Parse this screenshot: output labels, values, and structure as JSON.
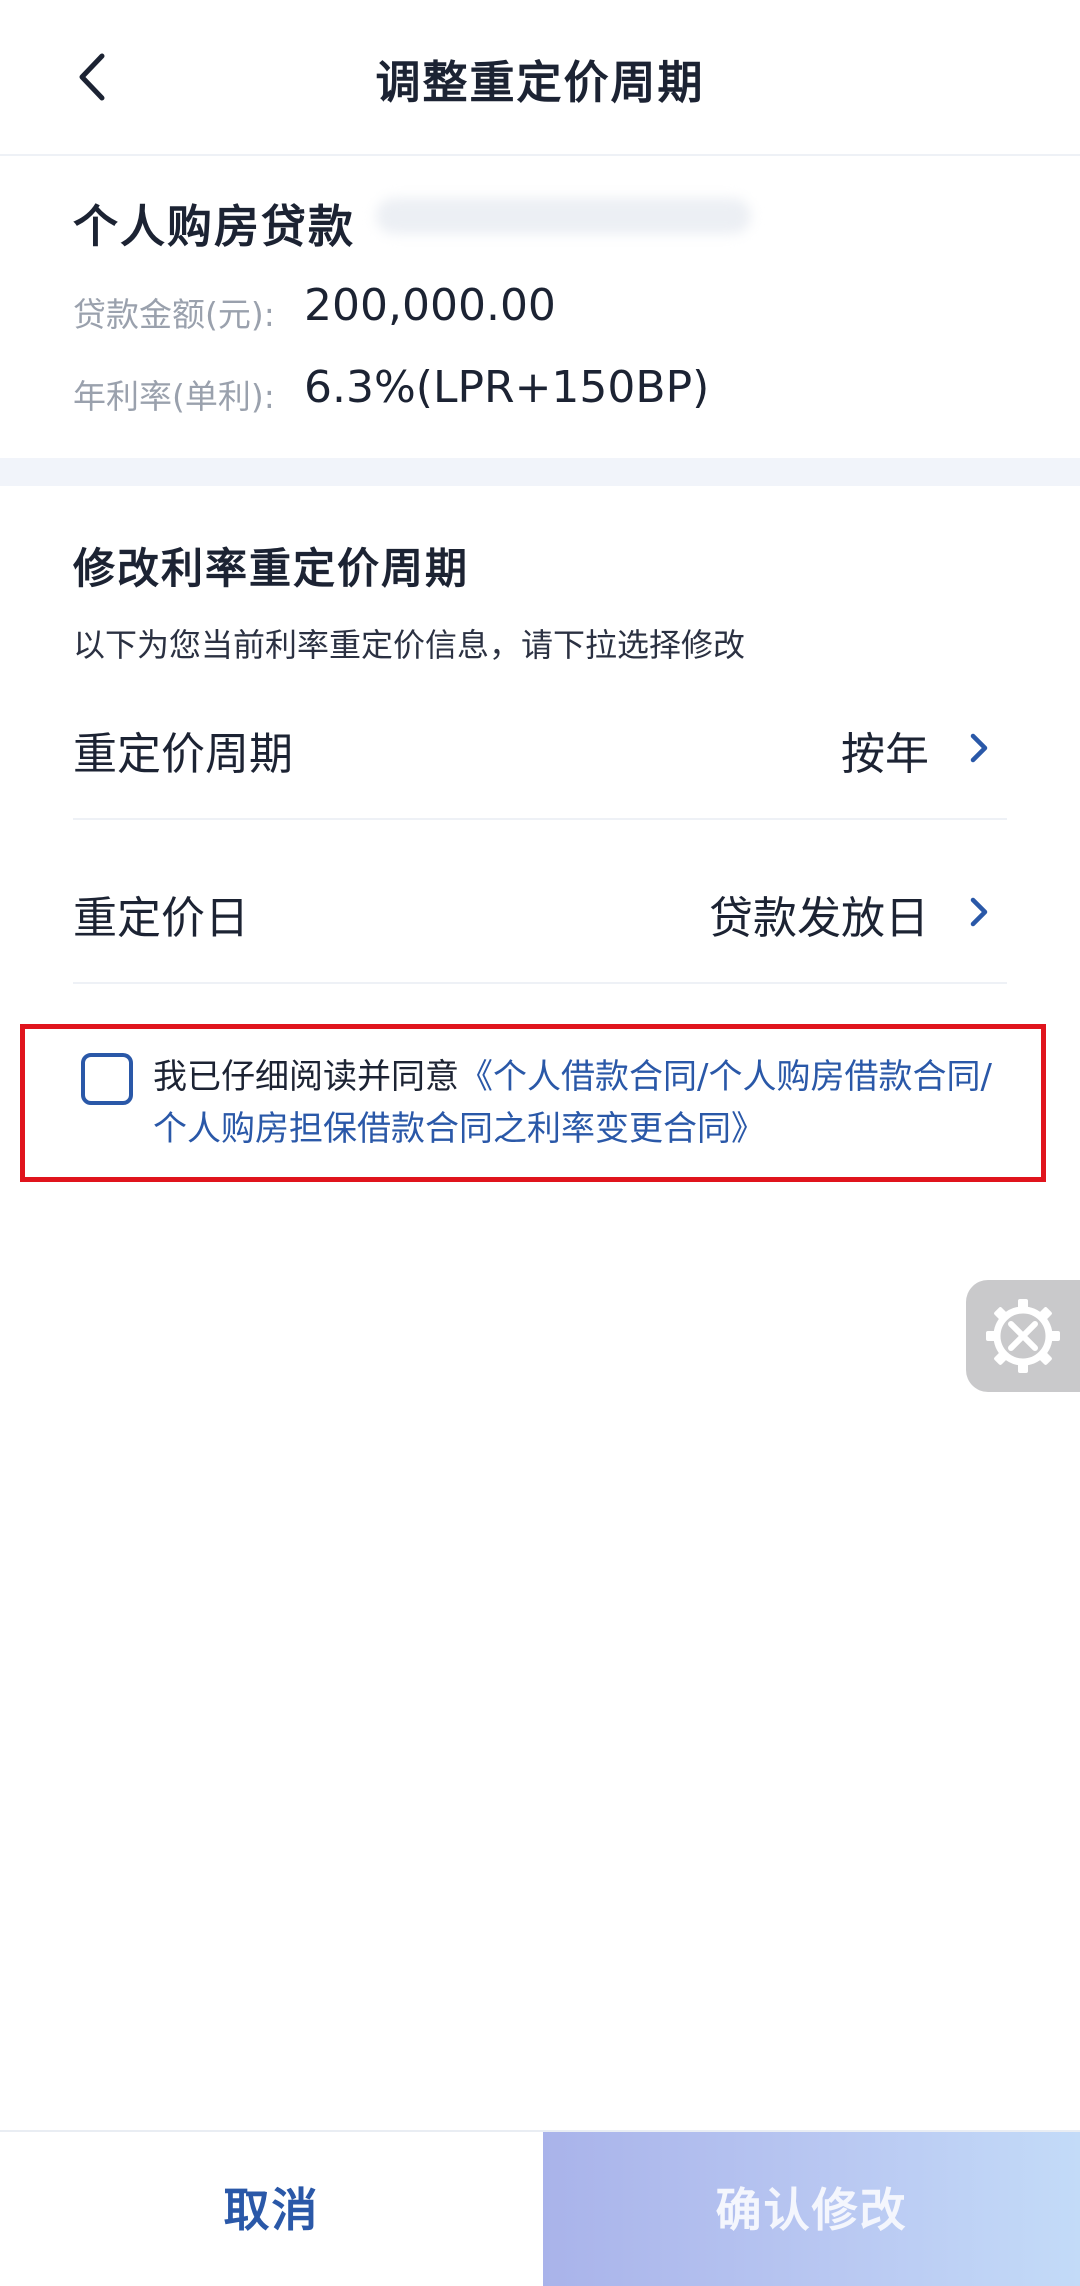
{
  "header": {
    "title": "调整重定价周期"
  },
  "loan": {
    "name": "个人购房贷款",
    "id_masked": "",
    "amount_label": "贷款金额(元):",
    "amount_value": "200,000.00",
    "rate_label": "年利率(单利):",
    "rate_value": "6.3%(LPR+150BP)"
  },
  "section": {
    "title": "修改利率重定价周期",
    "subtitle": "以下为您当前利率重定价信息，请下拉选择修改"
  },
  "rows": {
    "period_label": "重定价周期",
    "period_value": "按年",
    "day_label": "重定价日",
    "day_value": "贷款发放日"
  },
  "agreement": {
    "prefix": "我已仔细阅读并同意",
    "link": "《个人借款合同/个人购房借款合同/个人购房担保借款合同之利率变更合同》",
    "checked": false
  },
  "footer": {
    "cancel_label": "取消",
    "confirm_label": "确认修改"
  },
  "colors": {
    "accent": "#2a58a8",
    "highlight_border": "#e0141d",
    "confirm_gradient_start": "#a9b3ea",
    "confirm_gradient_end": "#c3dbf8"
  },
  "icons": {
    "back": "back-arrow-icon",
    "row_chevron": "chevron-right-icon",
    "float_tool": "gear-tools-icon"
  }
}
